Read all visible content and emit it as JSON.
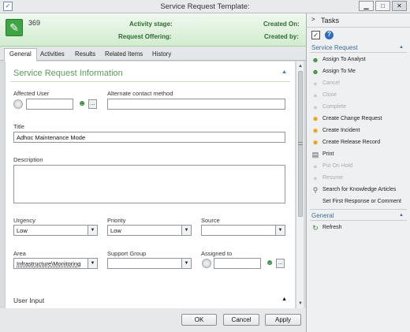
{
  "window": {
    "title": "Service Request Template:"
  },
  "header": {
    "id": "369",
    "activity_stage_label": "Activity stage:",
    "request_offering_label": "Request Offering:",
    "created_on_label": "Created On:",
    "created_by_label": "Created by:"
  },
  "tabs": [
    {
      "label": "General",
      "active": true
    },
    {
      "label": "Activities"
    },
    {
      "label": "Results"
    },
    {
      "label": "Related Items"
    },
    {
      "label": "History"
    }
  ],
  "form": {
    "section_title": "Service Request Information",
    "affected_user_label": "Affected User",
    "affected_user_value": "",
    "alternate_contact_label": "Alternate contact method",
    "alternate_contact_value": "",
    "title_label": "Title",
    "title_value": "Adhoc Maintenance Mode",
    "description_label": "Description",
    "urgency_label": "Urgency",
    "urgency_value": "Low",
    "priority_label": "Priority",
    "priority_value": "Low",
    "source_label": "Source",
    "source_value": "",
    "area_label": "Area",
    "area_value": "Infrastructure\\Monitoring",
    "support_group_label": "Support Group",
    "support_group_value": "",
    "assigned_to_label": "Assigned to",
    "assigned_to_value": "",
    "user_input_label": "User Input"
  },
  "footer": {
    "ok": "OK",
    "cancel": "Cancel",
    "apply": "Apply"
  },
  "tasks": {
    "title": "Tasks",
    "group1": "Service Request",
    "items": [
      {
        "label": "Assign To Analyst",
        "icon": "assign-icon",
        "enabled": true
      },
      {
        "label": "Assign To Me",
        "icon": "assign-icon",
        "enabled": true
      },
      {
        "label": "Cancel",
        "icon": "cancel-icon",
        "enabled": false
      },
      {
        "label": "Close",
        "icon": "close-icon",
        "enabled": false
      },
      {
        "label": "Complete",
        "icon": "complete-icon",
        "enabled": false
      },
      {
        "label": "Create Change Request",
        "icon": "star-icon",
        "enabled": true
      },
      {
        "label": "Create Incident",
        "icon": "star-icon",
        "enabled": true
      },
      {
        "label": "Create Release Record",
        "icon": "star-icon",
        "enabled": true
      },
      {
        "label": "Print",
        "icon": "printer-icon",
        "enabled": true
      },
      {
        "label": "Put On Hold",
        "icon": "hold-icon",
        "enabled": false
      },
      {
        "label": "Resume",
        "icon": "resume-icon",
        "enabled": false
      },
      {
        "label": "Search for Knowledge Articles",
        "icon": "search-icon",
        "enabled": true
      },
      {
        "label": "Set First Response or Comment",
        "icon": "comment-icon",
        "enabled": true
      }
    ],
    "group2": "General",
    "general_items": [
      {
        "label": "Refresh",
        "icon": "refresh-icon",
        "enabled": true
      }
    ]
  },
  "colors": {
    "header_green": "#d2ecd0",
    "accent_green": "#3fa443",
    "group_blue": "#3d6f98"
  }
}
